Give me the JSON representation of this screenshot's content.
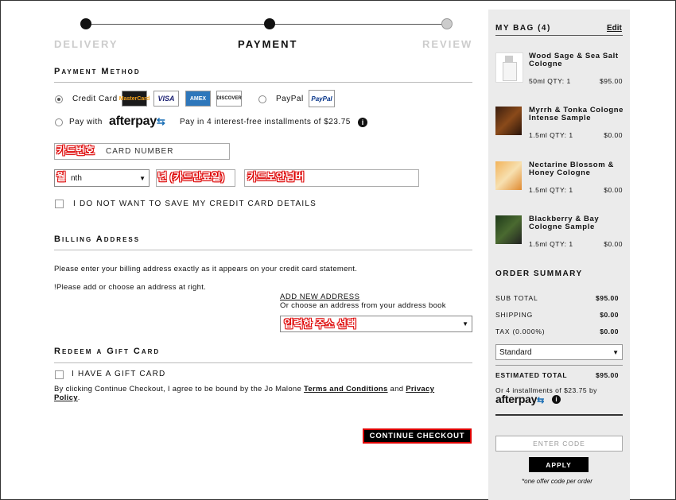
{
  "steps": {
    "delivery": "DELIVERY",
    "payment": "PAYMENT",
    "review": "REVIEW"
  },
  "payment_method": {
    "title": "Payment Method",
    "credit_card_label": "Credit Card",
    "card_logos": [
      "MasterCard",
      "VISA",
      "AMEX",
      "DISCOVER"
    ],
    "paypal_label": "PayPal",
    "paypal_logo": "PayPal",
    "pay_with_label": "Pay with",
    "afterpay_logo": "afterpay",
    "afterpay_text": "Pay in 4 interest-free installments of $23.75",
    "card_number_placeholder": "CARD NUMBER",
    "month_value": "nth",
    "save_card_label": "I DO NOT WANT TO SAVE MY CREDIT CARD DETAILS"
  },
  "annotations": {
    "card_number": "카드번호",
    "month": "월",
    "year": "년 (카드만료일)",
    "cvv": "카드보안넘버",
    "address": "입력한 주소 선택"
  },
  "billing": {
    "title": "Billing Address",
    "text1": "Please enter your billing address exactly as it appears on your credit card statement.",
    "text2": "!Please add or choose an address at right.",
    "add_new": "ADD NEW ADDRESS",
    "or_choose": "Or choose an address from your address book"
  },
  "gift": {
    "title": "Redeem a Gift Card",
    "checkbox_label": "I HAVE A GIFT CARD",
    "terms_prefix": "By clicking Continue Checkout, I agree to be bound by the Jo Malone ",
    "terms_link": "Terms and Conditions",
    "and": " and ",
    "privacy_link_1": "Privacy",
    "privacy_link_2": "Policy",
    "period": "."
  },
  "continue_label": "CONTINUE CHECKOUT",
  "bag": {
    "title": "MY BAG (4)",
    "edit": "Edit",
    "items": [
      {
        "name": "Wood Sage & Sea Salt Cologne",
        "size": "50ml QTY: 1",
        "price": "$95.00"
      },
      {
        "name": "Myrrh & Tonka Cologne Intense Sample",
        "size": "1.5ml QTY: 1",
        "price": "$0.00"
      },
      {
        "name": "Nectarine Blossom & Honey Cologne",
        "size": "1.5ml QTY: 1",
        "price": "$0.00"
      },
      {
        "name": "Blackberry & Bay Cologne Sample",
        "size": "1.5ml QTY: 1",
        "price": "$0.00"
      }
    ]
  },
  "summary": {
    "title": "ORDER SUMMARY",
    "subtotal_label": "SUB TOTAL",
    "subtotal": "$95.00",
    "shipping_label": "SHIPPING",
    "shipping": "$0.00",
    "tax_label": "TAX (0.000%)",
    "tax": "$0.00",
    "shipping_method": "Standard",
    "estimated_label": "ESTIMATED TOTAL",
    "estimated": "$95.00",
    "installments": "Or 4 installments of $23.75 by",
    "afterpay_logo": "afterpay",
    "code_placeholder": "ENTER CODE",
    "apply": "APPLY",
    "offer_note": "*one offer code per order"
  },
  "colors": {
    "annotation_red": "#dd0000",
    "afterpay_accent": "#1b6fb5",
    "paypal_blue": "#003087"
  }
}
